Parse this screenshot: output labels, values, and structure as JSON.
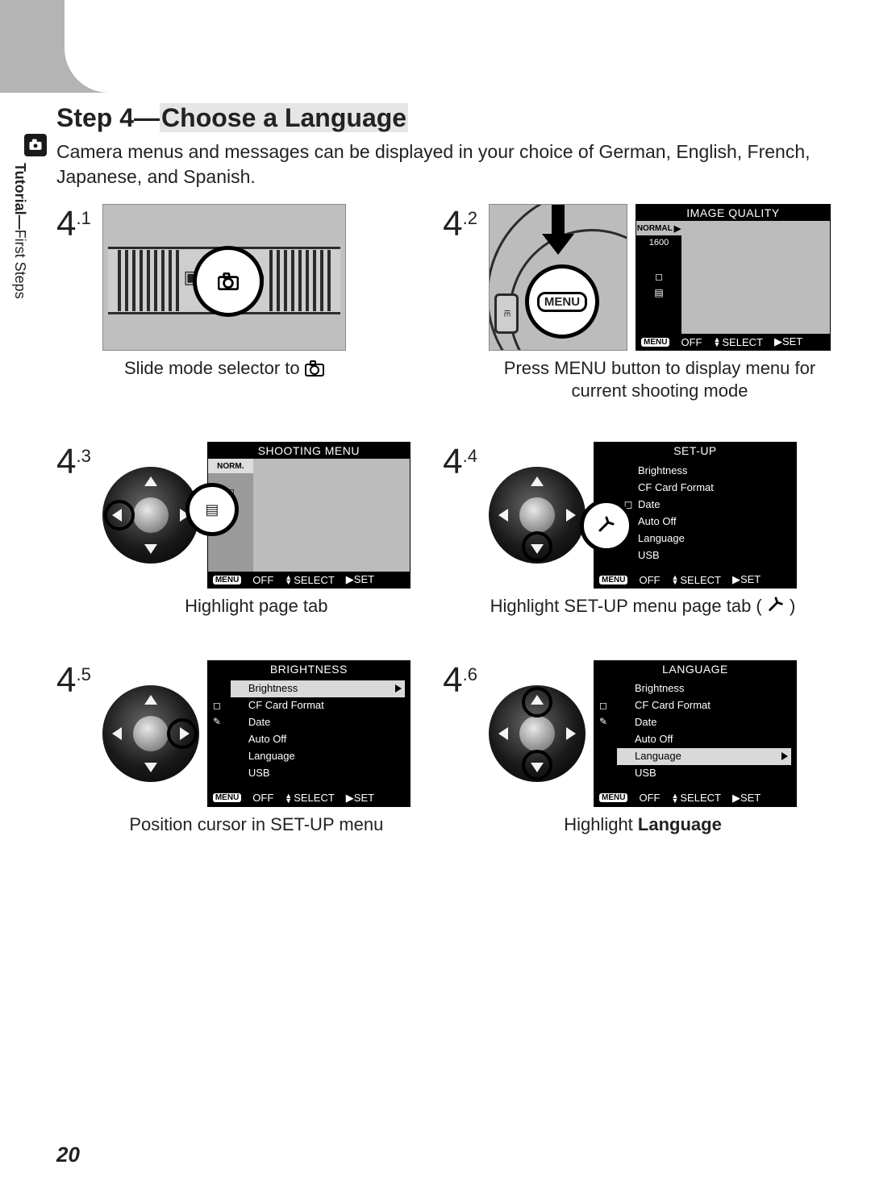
{
  "page_number": "20",
  "side_label_bold": "Tutorial—",
  "side_label_rest": "First Steps",
  "title_prefix": "Step 4—",
  "title_hl": "Choose a Language",
  "intro": "Camera menus and messages can be displayed in your choice of German, English, French, Japanese, and Spanish.",
  "common": {
    "menu_chip": "MENU",
    "bottom_off": "OFF",
    "bottom_select": "SELECT",
    "bottom_set": "SET",
    "sidebar_normal": "NORMAL",
    "sidebar_norm": "NORM.",
    "sidebar_1600": "1600"
  },
  "steps": {
    "s1": {
      "num": "4",
      "sub": ".1",
      "caption_a": "Slide mode selector to ",
      "caption_icon": "camera"
    },
    "s2": {
      "num": "4",
      "sub": ".2",
      "caption": "Press MENU button to display menu for current shooting mode",
      "lcd_title": "IMAGE QUALITY"
    },
    "s3": {
      "num": "4",
      "sub": ".3",
      "caption": "Highlight page tab",
      "lcd_title": "SHOOTING MENU"
    },
    "s4": {
      "num": "4",
      "sub": ".4",
      "caption_a": "Highlight SET-UP menu page tab (",
      "caption_b": ")",
      "lcd_title": "SET-UP",
      "items": [
        "Brightness",
        "CF Card Format",
        "Date",
        "Auto Off",
        "Language",
        "USB"
      ]
    },
    "s5": {
      "num": "4",
      "sub": ".5",
      "caption": "Position cursor in SET-UP menu",
      "lcd_title": "BRIGHTNESS",
      "items": [
        "Brightness",
        "CF Card Format",
        "Date",
        "Auto Off",
        "Language",
        "USB"
      ],
      "selected": 0
    },
    "s6": {
      "num": "4",
      "sub": ".6",
      "caption_a": "Highlight ",
      "caption_b": "Language",
      "lcd_title": "LANGUAGE",
      "items": [
        "Brightness",
        "CF Card Format",
        "Date",
        "Auto Off",
        "Language",
        "USB"
      ],
      "selected": 4
    }
  }
}
